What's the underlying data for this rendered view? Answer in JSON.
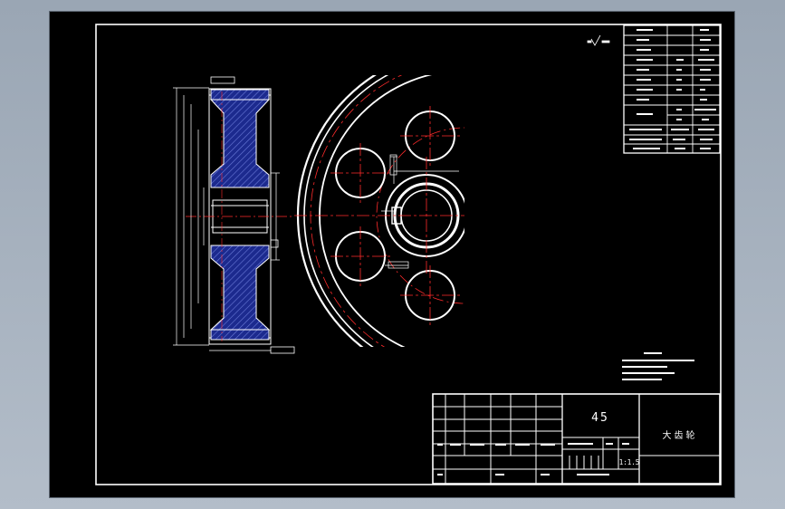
{
  "material": "45",
  "part_name": "大齿轮",
  "scale": "1:1.5",
  "colors": {
    "background": "#000000",
    "frame": "#ffffff",
    "centerline": "#ff2b2b",
    "hatch": "#2a3aa8",
    "dimension": "#ffffff"
  }
}
